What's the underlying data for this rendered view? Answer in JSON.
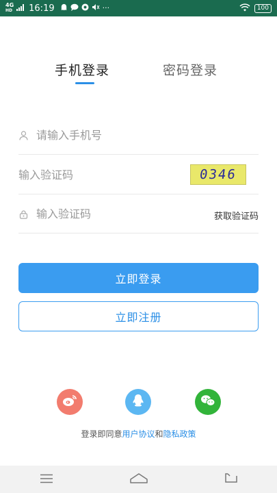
{
  "status_bar": {
    "network": "4G",
    "hd": "HD",
    "time": "16:19",
    "notification_icons": [
      "ghost-icon",
      "message-icon",
      "photo-icon",
      "mute-icon",
      "more-icon"
    ],
    "more": "···",
    "battery": "100"
  },
  "tabs": [
    {
      "label": "手机登录",
      "active": true
    },
    {
      "label": "密码登录",
      "active": false
    }
  ],
  "form": {
    "phone_placeholder": "请输入手机号",
    "captcha_placeholder": "输入验证码",
    "captcha_code": "0346",
    "sms_placeholder": "输入验证码",
    "get_code_label": "获取验证码"
  },
  "buttons": {
    "login": "立即登录",
    "register": "立即注册"
  },
  "social": [
    "weibo-icon",
    "qq-icon",
    "wechat-icon"
  ],
  "agreement": {
    "prefix": "登录即同意",
    "user_agreement": "用户协议",
    "and": "和",
    "privacy_policy": "隐私政策"
  },
  "colors": {
    "accent": "#3a9cf0",
    "status_bar": "#1a6b4f",
    "weibo": "#f27c6e",
    "qq": "#5cb7f2",
    "wechat": "#32b43a"
  }
}
